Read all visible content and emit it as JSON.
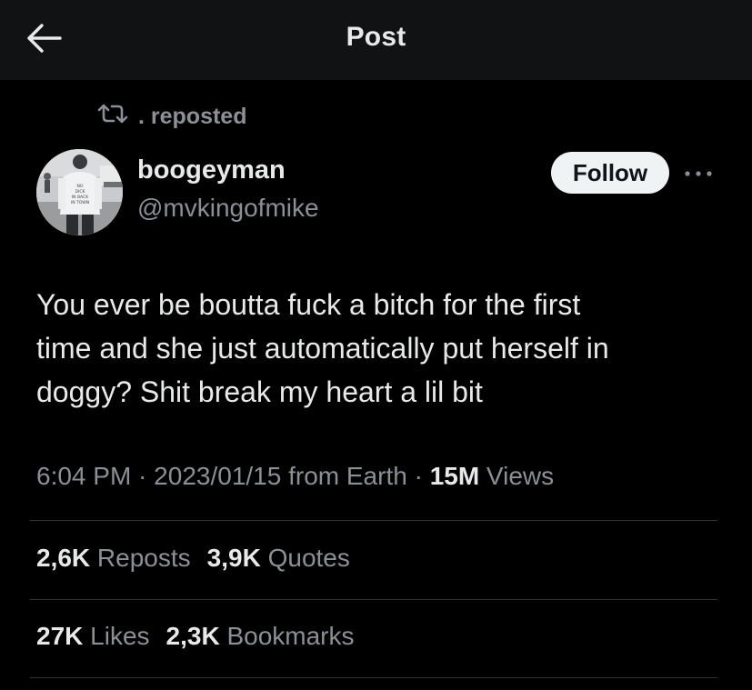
{
  "header": {
    "title": "Post",
    "back_icon": "arrow-left-icon"
  },
  "repost": {
    "icon": "retweet-icon",
    "text": ". reposted"
  },
  "author": {
    "display_name": "boogeyman",
    "handle": "@mvkingofmike",
    "avatar_shirt_text": "NO DICK IN BACK IN TOWN"
  },
  "actions": {
    "follow_label": "Follow",
    "more_icon": "more-horizontal-icon"
  },
  "post": {
    "text_lines": [
      "You ever be boutta fuck a bitch for the first",
      "time and she just automatically put herself in",
      "doggy? Shit break my heart a lil bit"
    ]
  },
  "meta": {
    "time": "6:04 PM",
    "sep1": " · ",
    "date": "2023/01/15",
    "source": " from Earth",
    "sep2": " · ",
    "views_count": "15M",
    "views_label": " Views"
  },
  "stats": {
    "reposts_count": "2,6K",
    "reposts_label": " Reposts",
    "quotes_count": "3,9K",
    "quotes_label": " Quotes",
    "likes_count": "27K",
    "likes_label": " Likes",
    "bookmarks_count": "2,3K",
    "bookmarks_label": " Bookmarks"
  },
  "colors": {
    "background": "#000000",
    "header_bg": "#111213",
    "primary_text": "#e7e9ea",
    "secondary_text": "#8b9096",
    "divider": "#2f3336",
    "follow_bg": "#eff3f4"
  }
}
